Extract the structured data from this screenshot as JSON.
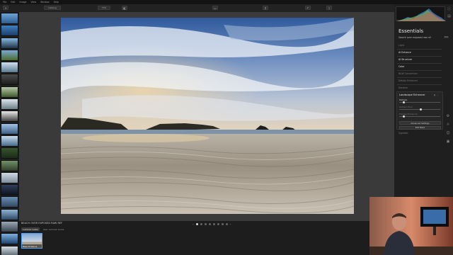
{
  "menu": [
    "File",
    "Edit",
    "Image",
    "View",
    "Window",
    "Help"
  ],
  "toolbar": {
    "catalog_label": "Catalog",
    "zoom_label": "73%",
    "tab_library": "Library",
    "tab_edit": "Edit",
    "tab_extra": "..."
  },
  "panel": {
    "title": "Essentials",
    "subtitle": "Search over exposed raw ref",
    "badge": "Edit",
    "sections": [
      {
        "label": "Light",
        "style": "dim"
      },
      {
        "label": "AI Enhance",
        "style": "bold"
      },
      {
        "label": "AI Structure",
        "style": "bold"
      },
      {
        "label": "Color",
        "style": "bold"
      },
      {
        "label": "B&W Conversion",
        "style": "dim"
      },
      {
        "label": "Details Enhancer",
        "style": "dim"
      },
      {
        "label": "Denoise",
        "style": "dim"
      }
    ],
    "landscape": {
      "title": "Landscape Enhancer",
      "rows": [
        {
          "label": "Dehaze",
          "value": 0.08,
          "dim": false
        },
        {
          "label": "Golden Hour",
          "value": 0.5,
          "dim": true
        },
        {
          "label": "Foliage Enhancer",
          "value": 0.08,
          "dim": true
        }
      ],
      "advanced_button": "Advanced Settings",
      "edit_mask_button": "Edit Mask"
    },
    "vignette_label": "Vignette"
  },
  "bottom": {
    "preset_title": "BEACH OVER EXPOSED RAW REF",
    "tabs": [
      {
        "label": "Luminar Looks",
        "active": true
      },
      {
        "label": "User Luminar Looks",
        "active": false
      }
    ],
    "save_look": "Save New Look",
    "selected_preset": "Basic Enhance",
    "page_count": 8,
    "active_page": 0
  },
  "colors": {
    "accent": "#4aa3ff",
    "panel_bg": "#1f1f20",
    "canvas_bg": "#3a3a3b"
  }
}
